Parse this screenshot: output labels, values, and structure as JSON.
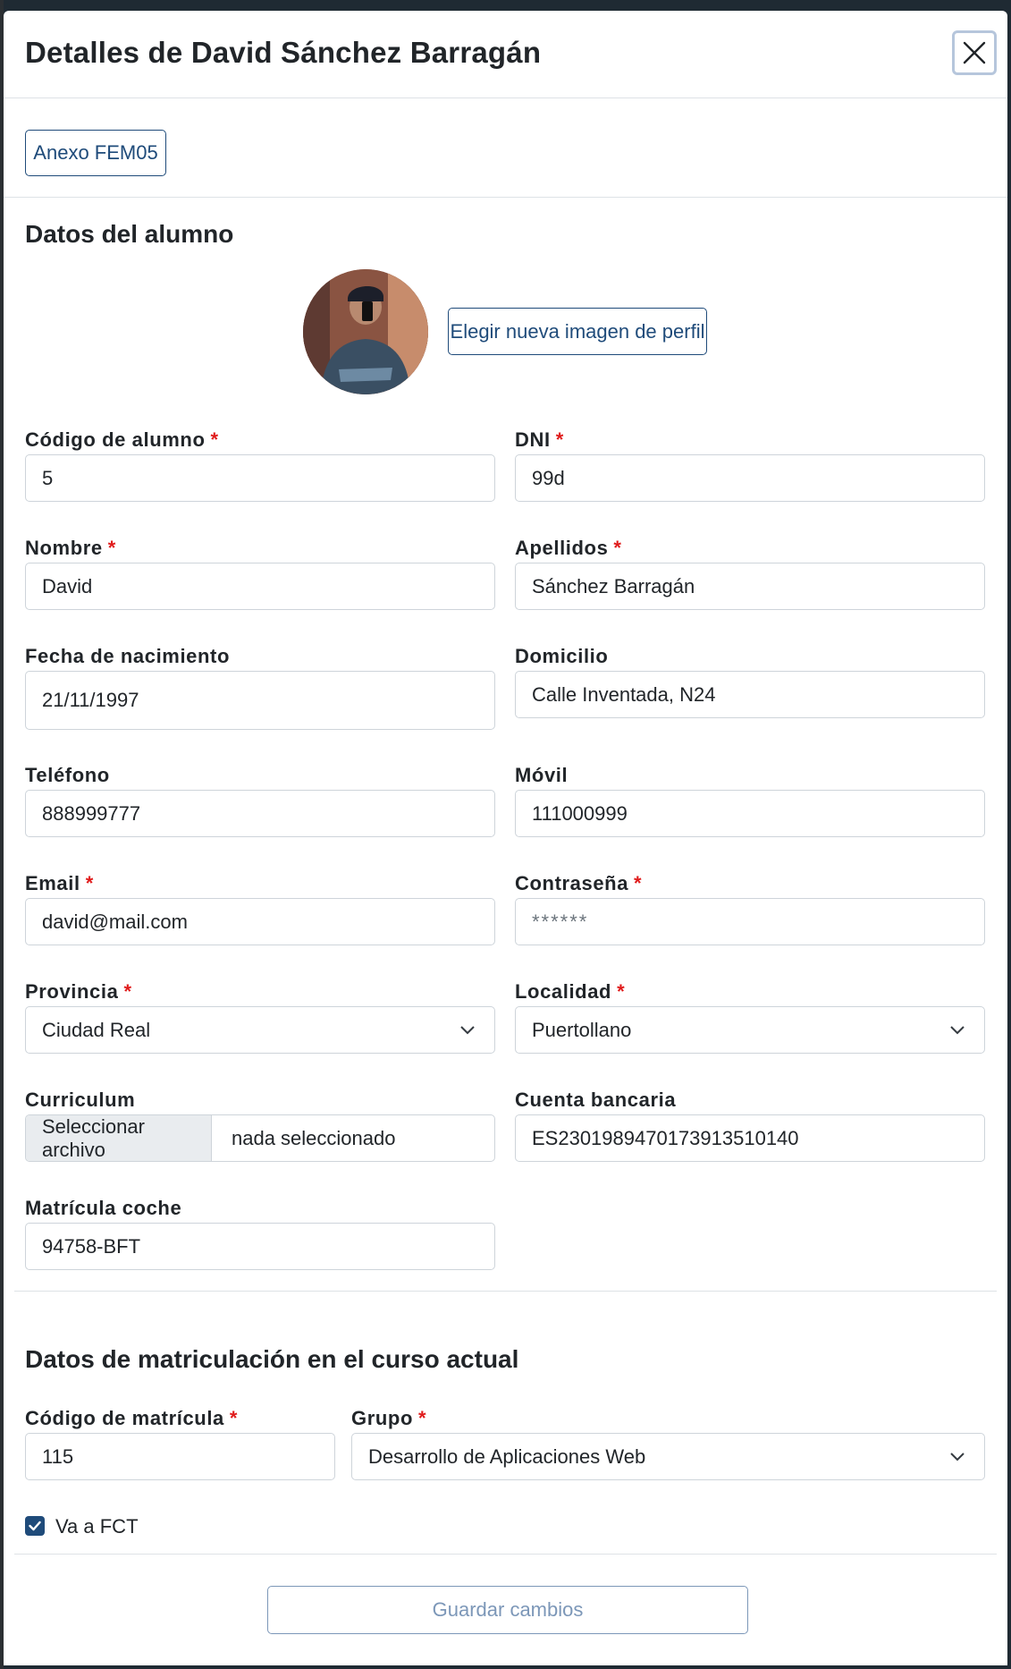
{
  "modal": {
    "title": "Detalles de David Sánchez Barragán"
  },
  "toolbar": {
    "annex_label": "Anexo FEM05"
  },
  "student_section": {
    "title": "Datos del alumno",
    "change_photo_label": "Elegir nueva imagen de perfil",
    "fields": {
      "codigo_alumno": {
        "label": "Código de alumno",
        "required": "*",
        "value": "5"
      },
      "dni": {
        "label": "DNI",
        "required": "*",
        "value": "99d"
      },
      "nombre": {
        "label": "Nombre",
        "required": "*",
        "value": "David"
      },
      "apellidos": {
        "label": "Apellidos",
        "required": "*",
        "value": "Sánchez Barragán"
      },
      "fecha_nacimiento": {
        "label": "Fecha de nacimiento",
        "value": "21/11/1997"
      },
      "domicilio": {
        "label": "Domicilio",
        "value": "Calle Inventada, N24"
      },
      "telefono": {
        "label": "Teléfono",
        "value": "888999777"
      },
      "movil": {
        "label": "Móvil",
        "value": "111000999"
      },
      "email": {
        "label": "Email",
        "required": "*",
        "value": "david@mail.com"
      },
      "contrasena": {
        "label": "Contraseña",
        "required": "*",
        "value": "******"
      },
      "provincia": {
        "label": "Provincia",
        "required": "*",
        "value": "Ciudad Real"
      },
      "localidad": {
        "label": "Localidad",
        "required": "*",
        "value": "Puertollano"
      },
      "curriculum": {
        "label": "Curriculum",
        "button_label": "Seleccionar archivo",
        "file_status": "nada seleccionado"
      },
      "cuenta_bancaria": {
        "label": "Cuenta bancaria",
        "value": "ES2301989470173913510140"
      },
      "matricula_coche": {
        "label": "Matrícula coche",
        "value": "94758-BFT"
      }
    }
  },
  "enrollment_section": {
    "title": "Datos de matriculación en el curso actual",
    "fields": {
      "codigo_matricula": {
        "label": "Código de matrícula",
        "required": "*",
        "value": "115"
      },
      "grupo": {
        "label": "Grupo",
        "required": "*",
        "value": "Desarrollo de Aplicaciones Web"
      }
    },
    "fct_checkbox": {
      "label": "Va a FCT",
      "checked": true
    }
  },
  "footer": {
    "save_label": "Guardar cambios"
  },
  "colors": {
    "accent": "#1f4b7a",
    "required": "#e01b1b",
    "disabled_button": "#7c97b8"
  }
}
